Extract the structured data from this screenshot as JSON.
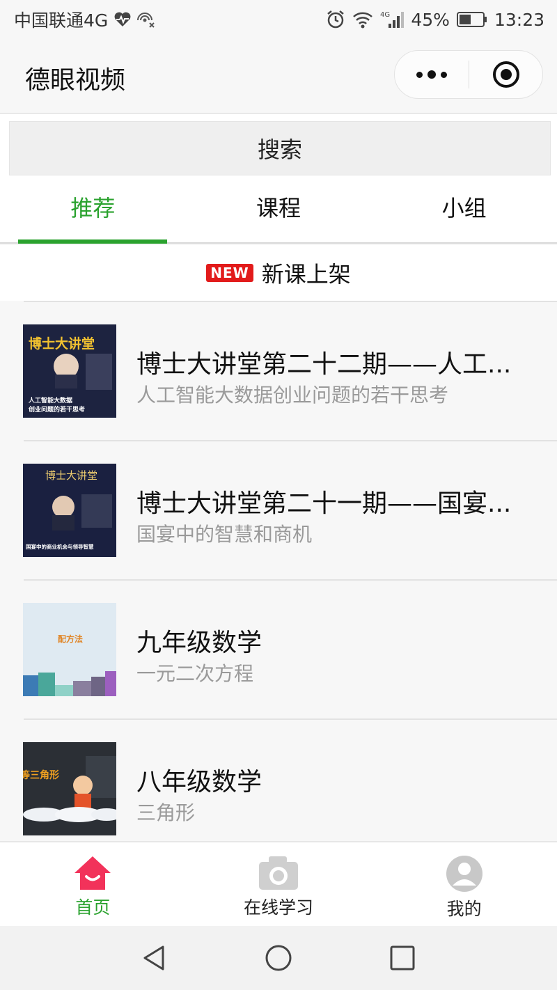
{
  "status_bar": {
    "carrier": "中国联通4G",
    "battery": "45%",
    "signal_label": "4G",
    "time": "13:23"
  },
  "title_bar": {
    "app_title": "德眼视频"
  },
  "search": {
    "label": "搜索"
  },
  "tabs": [
    {
      "label": "推荐",
      "active": true
    },
    {
      "label": "课程",
      "active": false
    },
    {
      "label": "小组",
      "active": false
    }
  ],
  "section": {
    "badge": "NEW",
    "title": "新课上架"
  },
  "courses": [
    {
      "title": "博士大讲堂第二十二期——人工...",
      "subtitle": "人工智能大数据创业问题的若干思考",
      "thumb": {
        "heading": "博士大讲堂",
        "caption_1": "人工智能大数据",
        "caption_2": "创业问题的若干思考"
      }
    },
    {
      "title": "博士大讲堂第二十一期——国宴...",
      "subtitle": "国宴中的智慧和商机",
      "thumb": {
        "heading": "博士大讲堂",
        "caption_1": "国宴中的商业机会与领导智慧"
      }
    },
    {
      "title": "九年级数学",
      "subtitle": "一元二次方程",
      "thumb": {
        "heading": "配方法"
      }
    },
    {
      "title": "八年级数学",
      "subtitle": "三角形",
      "thumb": {
        "heading": "等三角形"
      }
    }
  ],
  "tabbar": [
    {
      "label": "首页",
      "icon": "home-icon",
      "active": true
    },
    {
      "label": "在线学习",
      "icon": "camera-icon",
      "active": false
    },
    {
      "label": "我的",
      "icon": "user-icon",
      "active": false
    }
  ],
  "colors": {
    "accent": "#2aa22e",
    "home_icon": "#f2325a",
    "new_badge": "#e21b1b"
  }
}
